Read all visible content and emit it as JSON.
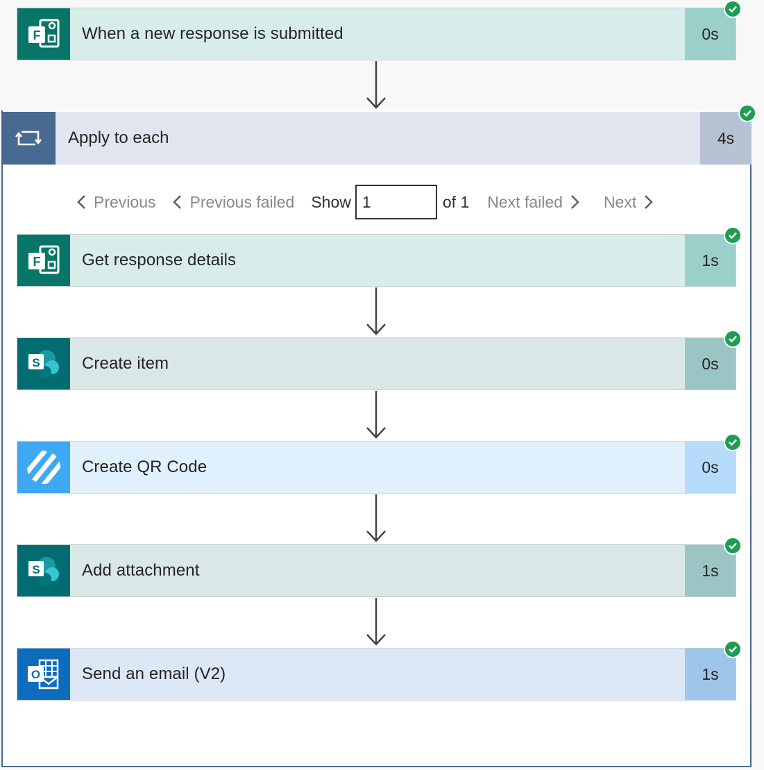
{
  "trigger": {
    "title": "When a new response is submitted",
    "duration": "0s"
  },
  "loop": {
    "title": "Apply to each",
    "duration": "4s"
  },
  "pager": {
    "previous": "Previous",
    "previous_failed": "Previous failed",
    "show": "Show",
    "current_value": "1",
    "of": "of 1",
    "next_failed": "Next failed",
    "next": "Next"
  },
  "actions": [
    {
      "title": "Get response details",
      "duration": "1s"
    },
    {
      "title": "Create item",
      "duration": "0s"
    },
    {
      "title": "Create QR Code",
      "duration": "0s"
    },
    {
      "title": "Add attachment",
      "duration": "1s"
    },
    {
      "title": "Send an email (V2)",
      "duration": "1s"
    }
  ],
  "colors": {
    "forms_icon": "#077568",
    "forms_card": "#d8ecea",
    "forms_dur": "#9bd0ca",
    "sharepoint_icon": "#036c70",
    "sharepoint_card": "#d9e7e7",
    "sharepoint_dur": "#9bc4c4",
    "qr_icon": "#3fa8f4",
    "qr_card": "#e1f0fd",
    "qr_dur": "#b7dcfb",
    "outlook_icon": "#0f6cbd",
    "outlook_card": "#dce8f6",
    "outlook_dur": "#9ec6ea",
    "success": "#1f9d55"
  }
}
